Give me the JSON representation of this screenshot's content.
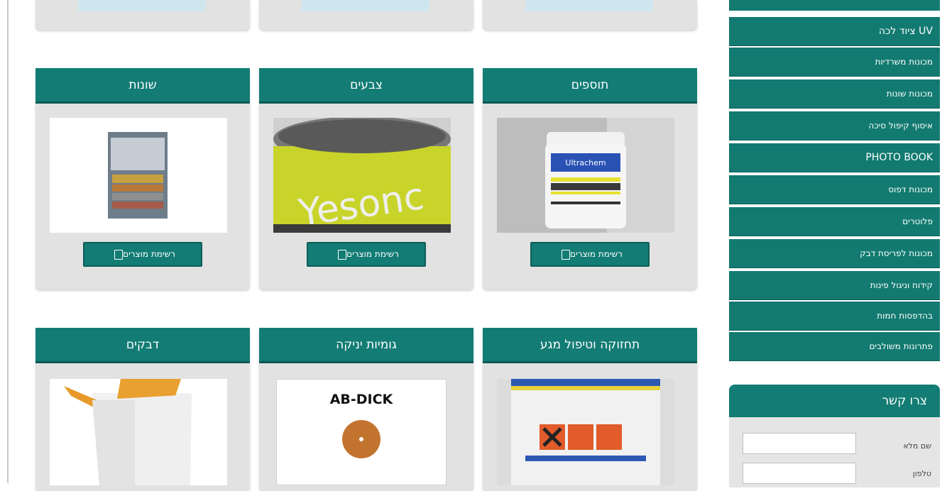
{
  "top_cards": 3,
  "products": [
    {
      "title": "תוספים",
      "button": "רשימת מוצרים"
    },
    {
      "title": "צבעים",
      "button": "רשימת מוצרים"
    },
    {
      "title": "שונות",
      "button": "רשימת מוצרים"
    }
  ],
  "products_row2": [
    {
      "title": "תחזוקה וטיפול מגע"
    },
    {
      "title": "גומיות יניקה",
      "image_text": "AB-DICK"
    },
    {
      "title": "דבקים"
    }
  ],
  "product_images": {
    "additive_label": "Ultrachem",
    "ink_label": "Yesonc"
  },
  "sidebar": {
    "items": [
      "ציוד לכה UV",
      "מכונות משרדיות",
      "מכונות שונות",
      "איסוף קיפול סיכה",
      "PHOTO BOOK",
      "מכונות דפוס",
      "פלוטרים",
      "מכונות לפריסת דבק",
      "קידוח וניגול פינות",
      "בהדפסות חמות",
      "פתרונות משולבים"
    ]
  },
  "contact": {
    "title": "צרו קשר",
    "fields": [
      {
        "label": "שם מלא"
      },
      {
        "label": "טלפון"
      }
    ]
  },
  "colors": {
    "teal": "#137c74",
    "card_bg": "#e2e2e2"
  }
}
